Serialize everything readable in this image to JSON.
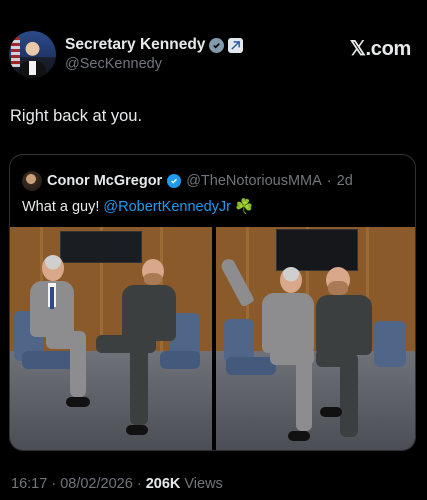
{
  "post": {
    "author": {
      "display_name": "Secretary Kennedy",
      "handle": "@SecKennedy",
      "verified_icon": "verified-gray-badge-icon",
      "affiliate_icon": "government-badge-icon"
    },
    "brand": "𝕏.com",
    "text": "Right back at you.",
    "quoted": {
      "author": {
        "display_name": "Conor McGregor",
        "handle": "@TheNotoriousMMA",
        "separator": "·",
        "age": "2d",
        "verified_icon": "verified-blue-badge-icon"
      },
      "text_prefix": "What a guy! ",
      "mention": "@RobertKennedyJr",
      "emoji": "☘️",
      "photos": [
        {
          "description_icon": "photo-seated-icon"
        },
        {
          "description_icon": "photo-selfie-icon"
        }
      ]
    },
    "meta": {
      "time": "16:17",
      "separator": "·",
      "date": "08/02/2026",
      "separator2": "·",
      "views_count": "206K",
      "views_label": "Views"
    }
  },
  "colors": {
    "background": "#000000",
    "text_primary": "#e7e9ea",
    "text_secondary": "#71767b",
    "link": "#1d9bf0",
    "border": "#2f3336",
    "verified_gray": "#829aab"
  }
}
